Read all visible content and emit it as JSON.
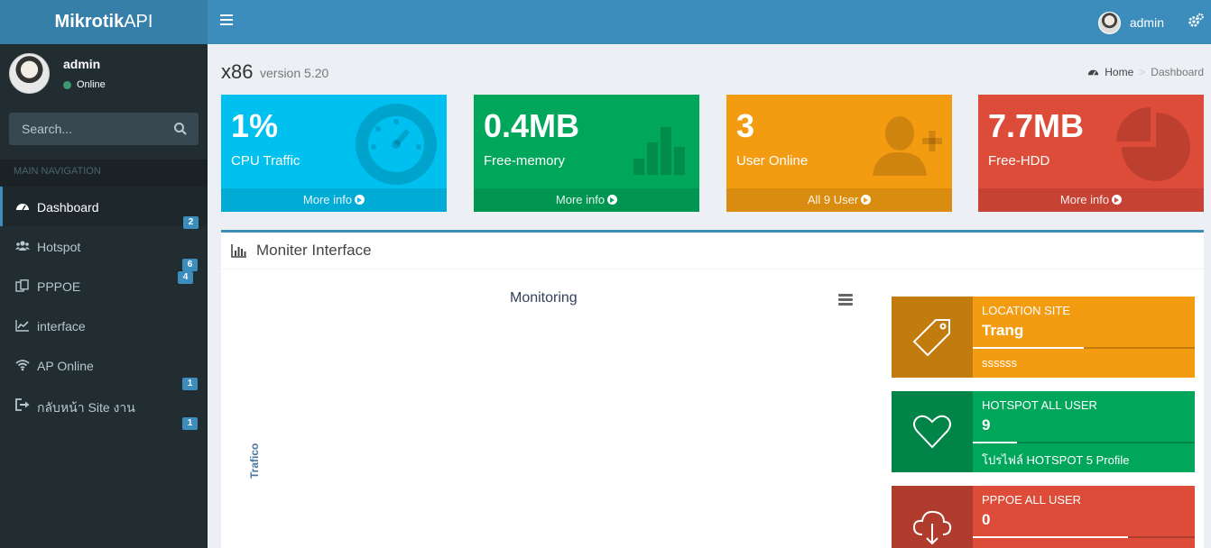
{
  "header": {
    "logo_bold": "Mikrotik",
    "logo_light": "API",
    "user_name": "admin"
  },
  "sidebar": {
    "user_name": "admin",
    "status": "Online",
    "search_placeholder": "Search...",
    "nav_header": "MAIN NAVIGATION",
    "items": [
      {
        "label": "Dashboard",
        "icon": "dashboard-icon",
        "badge": "2"
      },
      {
        "label": "Hotspot",
        "icon": "users-icon",
        "badge": "6"
      },
      {
        "label": "PPPOE",
        "icon": "copy-icon",
        "badge": "4"
      },
      {
        "label": "interface",
        "icon": "line-chart-icon",
        "badge": ""
      },
      {
        "label": "AP Online",
        "icon": "wifi-icon",
        "badge": "1"
      },
      {
        "label": "กลับหน้า Site งาน",
        "icon": "sign-out-icon",
        "badge": "1"
      }
    ]
  },
  "page": {
    "title": "x86",
    "subtitle": "version 5.20",
    "breadcrumb_home": "Home",
    "breadcrumb_current": "Dashboard"
  },
  "stats": [
    {
      "value": "1%",
      "label": "CPU Traffic",
      "footer": "More info",
      "color": "#00c0ef",
      "icon": "dashboard-icon"
    },
    {
      "value": "0.4MB",
      "label": "Free-memory",
      "footer": "More info",
      "color": "#00a65a",
      "icon": "bar-chart-icon"
    },
    {
      "value": "3",
      "label": "User Online",
      "footer": "All 9 User",
      "color": "#f39c12",
      "icon": "user-plus-icon"
    },
    {
      "value": "7.7MB",
      "label": "Free-HDD",
      "footer": "More info",
      "color": "#dd4b39",
      "icon": "pie-chart-icon"
    }
  ],
  "monitor": {
    "panel_title": "Moniter Interface",
    "chart_title": "Monitoring",
    "y_axis_label": "Trafico"
  },
  "info_boxes": [
    {
      "title": "LOCATION SITE",
      "value": "Trang",
      "desc": "ssssss",
      "progress": 0.5,
      "color": "#f39c12",
      "icon": "tag-icon"
    },
    {
      "title": "HOTSPOT ALL USER",
      "value": "9",
      "desc": "โปรไฟล์ HOTSPOT 5 Profile",
      "progress": 0.2,
      "color": "#00a65a",
      "icon": "heart-icon"
    },
    {
      "title": "PPPOE ALL USER",
      "value": "0",
      "desc": "",
      "progress": 0.7,
      "color": "#dd4b39",
      "icon": "cloud-download-icon"
    }
  ]
}
